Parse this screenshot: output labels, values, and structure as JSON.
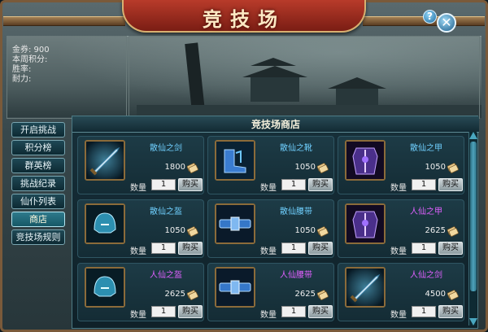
{
  "window": {
    "title": "竞技场",
    "help_label": "?",
    "close_label": "✕"
  },
  "stats": {
    "lines": [
      "金券: 900",
      "本周积分:",
      "胜率:",
      "耐力:"
    ]
  },
  "menu": {
    "items": [
      {
        "label": "开启挑战",
        "active": false
      },
      {
        "label": "积分榜",
        "active": false
      },
      {
        "label": "群英榜",
        "active": false
      },
      {
        "label": "挑战纪录",
        "active": false
      },
      {
        "label": "仙仆列表",
        "active": false
      },
      {
        "label": "商店",
        "active": true
      },
      {
        "label": "竞技场规则",
        "active": false
      }
    ]
  },
  "shop": {
    "title": "竞技场商店",
    "qty_label": "数量",
    "buy_label": "购买",
    "items": [
      {
        "name": "散仙之剑",
        "price": "1800",
        "qty": "1",
        "name_color": "#6fd0ff",
        "icon": "sword-icon"
      },
      {
        "name": "散仙之靴",
        "price": "1050",
        "qty": "1",
        "name_color": "#6fd0ff",
        "icon": "boots-icon"
      },
      {
        "name": "散仙之甲",
        "price": "1050",
        "qty": "1",
        "name_color": "#6fd0ff",
        "icon": "armor-icon"
      },
      {
        "name": "散仙之盔",
        "price": "1050",
        "qty": "1",
        "name_color": "#6fd0ff",
        "icon": "helmet-icon"
      },
      {
        "name": "散仙腰带",
        "price": "1050",
        "qty": "1",
        "name_color": "#6fd0ff",
        "icon": "belt-icon"
      },
      {
        "name": "人仙之甲",
        "price": "2625",
        "qty": "1",
        "name_color": "#e060ff",
        "icon": "armor-icon"
      },
      {
        "name": "人仙之盔",
        "price": "2625",
        "qty": "1",
        "name_color": "#e060ff",
        "icon": "helmet-icon"
      },
      {
        "name": "人仙腰带",
        "price": "2625",
        "qty": "1",
        "name_color": "#e060ff",
        "icon": "belt-icon"
      },
      {
        "name": "人仙之剑",
        "price": "4500",
        "qty": "1",
        "name_color": "#e060ff",
        "icon": "sword-icon"
      }
    ]
  }
}
